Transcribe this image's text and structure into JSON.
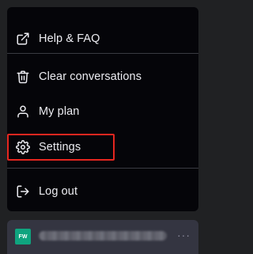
{
  "menu": {
    "items": [
      {
        "label": "Help & FAQ",
        "icon": "external-link-icon"
      },
      {
        "label": "Clear conversations",
        "icon": "trash-icon"
      },
      {
        "label": "My plan",
        "icon": "user-icon"
      },
      {
        "label": "Settings",
        "icon": "gear-icon"
      },
      {
        "label": "Log out",
        "icon": "logout-icon"
      }
    ]
  },
  "profile": {
    "avatar_initials": "FW",
    "more_label": "···"
  },
  "colors": {
    "highlight": "#e5261f",
    "avatar_bg": "#0fa47f",
    "menu_bg": "#050509"
  }
}
